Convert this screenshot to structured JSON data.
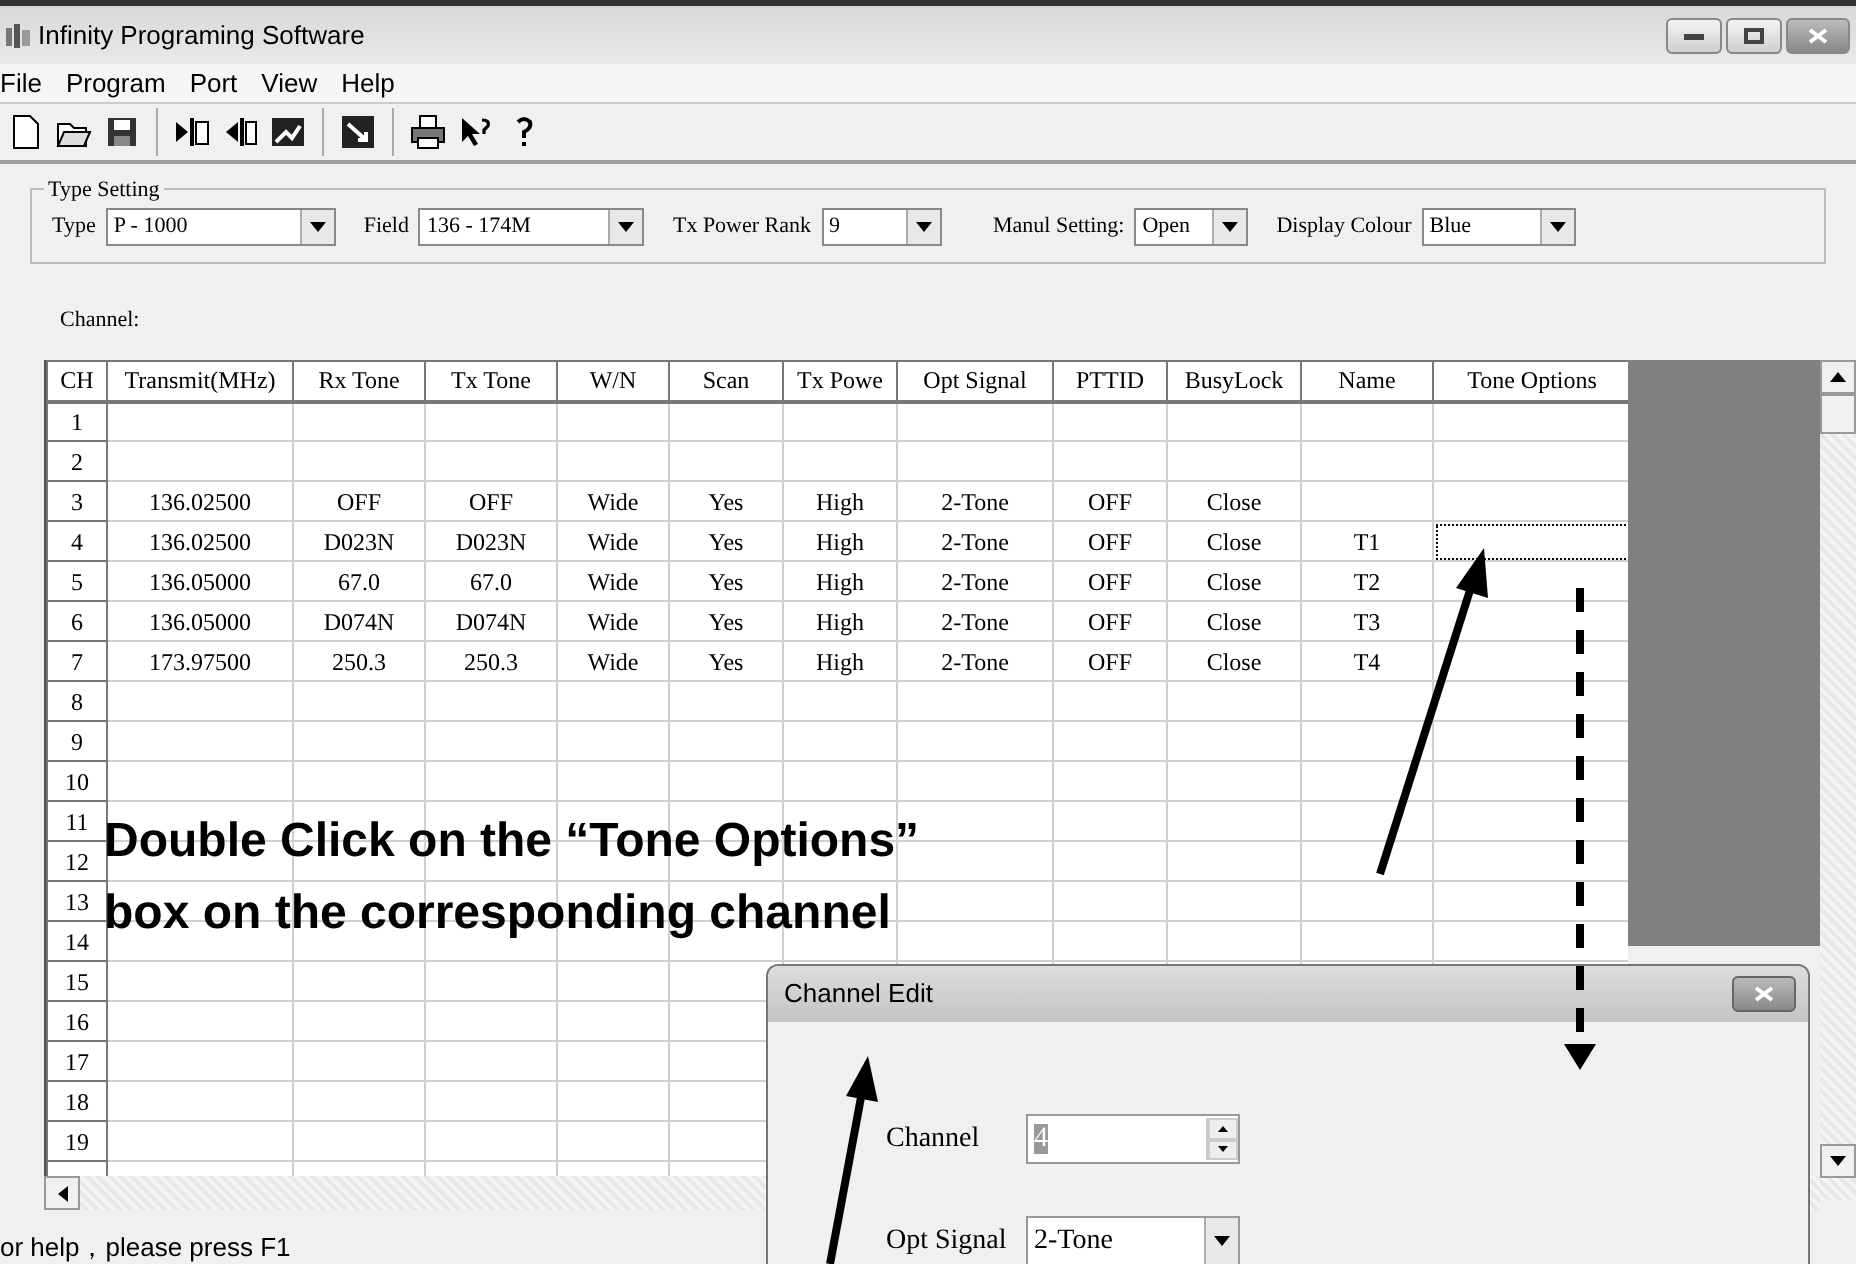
{
  "window": {
    "title": "Infinity Programing Software"
  },
  "menu": [
    "File",
    "Program",
    "Port",
    "View",
    "Help"
  ],
  "type_setting": {
    "title": "Type Setting",
    "fields": [
      {
        "label": "Type",
        "value": "P - 1000"
      },
      {
        "label": "Field",
        "value": "136 - 174M"
      },
      {
        "label": "Tx Power Rank",
        "value": "9"
      },
      {
        "label": "Manul Setting:",
        "value": "Open"
      },
      {
        "label": "Display Colour",
        "value": "Blue"
      }
    ]
  },
  "channel_label": "Channel:",
  "table": {
    "columns": [
      "CH",
      "Transmit(MHz)",
      "Rx Tone",
      "Tx Tone",
      "W/N",
      "Scan",
      "Tx Powe",
      "Opt Signal",
      "PTTID",
      "BusyLock",
      "Name",
      "Tone Options"
    ],
    "rows": [
      {
        "ch": "1"
      },
      {
        "ch": "2"
      },
      {
        "ch": "3",
        "cells": [
          {
            "text": "136.02500",
            "focused": false
          },
          {
            "text": "OFF",
            "focused": false
          },
          {
            "text": "OFF",
            "focused": false
          },
          {
            "text": "Wide",
            "focused": false
          },
          {
            "text": "Yes",
            "focused": false
          },
          {
            "text": "High",
            "focused": false
          },
          {
            "text": "2-Tone",
            "focused": false
          },
          {
            "text": "OFF",
            "focused": false
          },
          {
            "text": "Close",
            "focused": false
          }
        ]
      },
      {
        "ch": "4",
        "cells": [
          {
            "text": "136.02500",
            "focused": false
          },
          {
            "text": "D023N",
            "focused": false
          },
          {
            "text": "D023N",
            "focused": false
          },
          {
            "text": "Wide",
            "focused": false
          },
          {
            "text": "Yes",
            "focused": false
          },
          {
            "text": "High",
            "focused": false
          },
          {
            "text": "2-Tone",
            "focused": false
          },
          {
            "text": "OFF",
            "focused": false
          },
          {
            "text": "Close",
            "focused": false
          },
          {
            "text": "T1",
            "focused": false
          },
          {
            "focused": true
          }
        ]
      },
      {
        "ch": "5",
        "cells": [
          {
            "text": "136.05000",
            "focused": false
          },
          {
            "text": "67.0",
            "focused": false
          },
          {
            "text": "67.0",
            "focused": false
          },
          {
            "text": "Wide",
            "focused": false
          },
          {
            "text": "Yes",
            "focused": false
          },
          {
            "text": "High",
            "focused": false
          },
          {
            "text": "2-Tone",
            "focused": false
          },
          {
            "text": "OFF",
            "focused": false
          },
          {
            "text": "Close",
            "focused": false
          },
          {
            "text": "T2",
            "focused": false
          }
        ]
      },
      {
        "ch": "6",
        "cells": [
          {
            "text": "136.05000",
            "focused": false
          },
          {
            "text": "D074N",
            "focused": false
          },
          {
            "text": "D074N",
            "focused": false
          },
          {
            "text": "Wide",
            "focused": false
          },
          {
            "text": "Yes",
            "focused": false
          },
          {
            "text": "High",
            "focused": false
          },
          {
            "text": "2-Tone",
            "focused": false
          },
          {
            "text": "OFF",
            "focused": false
          },
          {
            "text": "Close",
            "focused": false
          },
          {
            "text": "T3",
            "focused": false
          }
        ]
      },
      {
        "ch": "7",
        "cells": [
          {
            "text": "173.97500",
            "focused": false
          },
          {
            "text": "250.3",
            "focused": false
          },
          {
            "text": "250.3",
            "focused": false
          },
          {
            "text": "Wide",
            "focused": false
          },
          {
            "text": "Yes",
            "focused": false
          },
          {
            "text": "High",
            "focused": false
          },
          {
            "text": "2-Tone",
            "focused": false
          },
          {
            "text": "OFF",
            "focused": false
          },
          {
            "text": "Close",
            "focused": false
          },
          {
            "text": "T4",
            "focused": false
          }
        ]
      },
      {
        "ch": "8"
      },
      {
        "ch": "9"
      },
      {
        "ch": "10"
      },
      {
        "ch": "11"
      },
      {
        "ch": "12"
      },
      {
        "ch": "13"
      },
      {
        "ch": "14"
      },
      {
        "ch": "15"
      },
      {
        "ch": "16"
      },
      {
        "ch": "17"
      },
      {
        "ch": "18"
      },
      {
        "ch": "19"
      }
    ]
  },
  "status_bar": "or help，please press F1",
  "annotation": {
    "lines": [
      "Double Click on the “Tone Options”",
      "box on the corresponding channel"
    ]
  },
  "dialog": {
    "title": "Channel Edit",
    "fields": [
      {
        "label": "Channel",
        "value": "4",
        "kind": "spin",
        "disabled": true
      },
      {
        "label": "Opt Signal",
        "value": "2-Tone",
        "kind": "combo",
        "disabled": false
      }
    ]
  }
}
